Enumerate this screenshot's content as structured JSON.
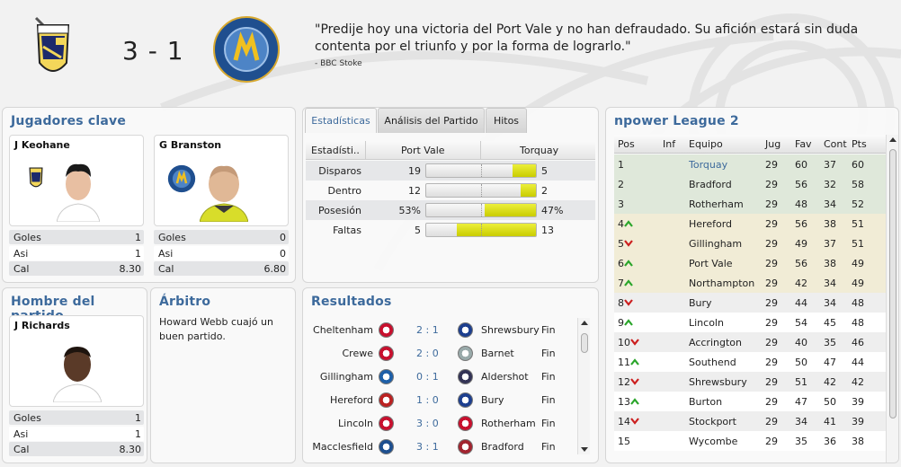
{
  "match": {
    "score": "3 - 1",
    "home_team": "Port Vale",
    "away_team": "Torquay",
    "quote": "\"Predije hoy una victoria del Port Vale y no han defraudado. Su afición estará sin duda contenta por el triunfo y por la forma de lograrlo.\"",
    "quote_source": "- BBC Stoke"
  },
  "key_players": {
    "title": "Jugadores clave",
    "players": [
      {
        "name": "J Keohane",
        "stats": [
          {
            "label": "Goles",
            "value": "1"
          },
          {
            "label": "Asi",
            "value": "1"
          },
          {
            "label": "Cal",
            "value": "8.30"
          }
        ]
      },
      {
        "name": "G Branston",
        "stats": [
          {
            "label": "Goles",
            "value": "0"
          },
          {
            "label": "Asi",
            "value": "0"
          },
          {
            "label": "Cal",
            "value": "6.80"
          }
        ]
      }
    ]
  },
  "man_of_match": {
    "title": "Hombre del partido",
    "name": "J Richards",
    "stats": [
      {
        "label": "Goles",
        "value": "1"
      },
      {
        "label": "Asi",
        "value": "1"
      },
      {
        "label": "Cal",
        "value": "8.30"
      }
    ]
  },
  "referee": {
    "title": "Árbitro",
    "text": "Howard Webb cuajó un buen partido."
  },
  "stats_panel": {
    "tabs": [
      "Estadísticas",
      "Análisis del Partido",
      "Hitos"
    ],
    "active_tab": 0,
    "headers": [
      "Estadísti..",
      "Port Vale",
      "Torquay"
    ],
    "rows": [
      {
        "label": "Disparos",
        "home": "19",
        "away": "5",
        "away_share": 0.21
      },
      {
        "label": "Dentro",
        "home": "12",
        "away": "2",
        "away_share": 0.14
      },
      {
        "label": "Posesión",
        "home": "53%",
        "away": "47%",
        "away_share": 0.47
      },
      {
        "label": "Faltas",
        "home": "5",
        "away": "13",
        "away_share": 0.72
      }
    ]
  },
  "results": {
    "title": "Resultados",
    "rows": [
      {
        "home": "Cheltenham",
        "score": "2 : 1",
        "away": "Shrewsbury",
        "status": "Fin"
      },
      {
        "home": "Crewe",
        "score": "2 : 0",
        "away": "Barnet",
        "status": "Fin"
      },
      {
        "home": "Gillingham",
        "score": "0 : 1",
        "away": "Aldershot",
        "status": "Fin"
      },
      {
        "home": "Hereford",
        "score": "1 : 0",
        "away": "Bury",
        "status": "Fin"
      },
      {
        "home": "Lincoln",
        "score": "3 : 0",
        "away": "Rotherham",
        "status": "Fin"
      },
      {
        "home": "Macclesfield",
        "score": "3 : 1",
        "away": "Bradford",
        "status": "Fin"
      }
    ]
  },
  "league": {
    "title": "npower League 2",
    "headers": [
      "Pos",
      "Inf",
      "Equipo",
      "Jug",
      "Fav",
      "Cont",
      "Pts"
    ],
    "rows": [
      {
        "pos": "1",
        "trend": "",
        "team": "Torquay",
        "pld": "29",
        "gf": "60",
        "ga": "37",
        "pts": "60",
        "highlight": "promo",
        "link": true
      },
      {
        "pos": "2",
        "trend": "",
        "team": "Bradford",
        "pld": "29",
        "gf": "56",
        "ga": "32",
        "pts": "58",
        "highlight": "promo"
      },
      {
        "pos": "3",
        "trend": "",
        "team": "Rotherham",
        "pld": "29",
        "gf": "48",
        "ga": "34",
        "pts": "52",
        "highlight": "promo"
      },
      {
        "pos": "4",
        "trend": "up",
        "team": "Hereford",
        "pld": "29",
        "gf": "56",
        "ga": "38",
        "pts": "51",
        "highlight": "playoff"
      },
      {
        "pos": "5",
        "trend": "down",
        "team": "Gillingham",
        "pld": "29",
        "gf": "49",
        "ga": "37",
        "pts": "51",
        "highlight": "playoff"
      },
      {
        "pos": "6",
        "trend": "up",
        "team": "Port Vale",
        "pld": "29",
        "gf": "56",
        "ga": "38",
        "pts": "49",
        "highlight": "playoff"
      },
      {
        "pos": "7",
        "trend": "up",
        "team": "Northampton",
        "pld": "29",
        "gf": "42",
        "ga": "34",
        "pts": "49",
        "highlight": "playoff"
      },
      {
        "pos": "8",
        "trend": "down",
        "team": "Bury",
        "pld": "29",
        "gf": "44",
        "ga": "34",
        "pts": "48",
        "highlight": ""
      },
      {
        "pos": "9",
        "trend": "up",
        "team": "Lincoln",
        "pld": "29",
        "gf": "54",
        "ga": "45",
        "pts": "48",
        "highlight": ""
      },
      {
        "pos": "10",
        "trend": "down",
        "team": "Accrington",
        "pld": "29",
        "gf": "40",
        "ga": "35",
        "pts": "46",
        "highlight": ""
      },
      {
        "pos": "11",
        "trend": "up",
        "team": "Southend",
        "pld": "29",
        "gf": "50",
        "ga": "47",
        "pts": "44",
        "highlight": ""
      },
      {
        "pos": "12",
        "trend": "down",
        "team": "Shrewsbury",
        "pld": "29",
        "gf": "51",
        "ga": "42",
        "pts": "42",
        "highlight": ""
      },
      {
        "pos": "13",
        "trend": "up",
        "team": "Burton",
        "pld": "29",
        "gf": "47",
        "ga": "50",
        "pts": "39",
        "highlight": ""
      },
      {
        "pos": "14",
        "trend": "down",
        "team": "Stockport",
        "pld": "29",
        "gf": "34",
        "ga": "41",
        "pts": "39",
        "highlight": ""
      },
      {
        "pos": "15",
        "trend": "",
        "team": "Wycombe",
        "pld": "29",
        "gf": "35",
        "ga": "36",
        "pts": "38",
        "highlight": ""
      }
    ]
  },
  "colors": {
    "accent": "#3d6a9c",
    "promo_row": "#dfe8da",
    "playoff_row": "#f1ecd6",
    "bar_fill": "#d8db10",
    "trend_up": "#2aa52a",
    "trend_down": "#cc1f1f"
  },
  "icons": [
    "port-vale-crest-icon",
    "torquay-crest-icon",
    "scroll-up-icon",
    "scroll-down-icon",
    "trend-up-icon",
    "trend-down-icon"
  ]
}
